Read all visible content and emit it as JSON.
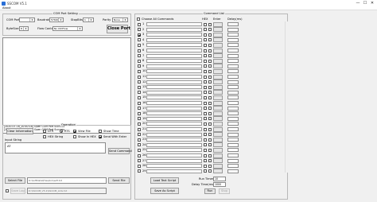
{
  "window": {
    "title": "SSCOM V5.1",
    "minimize": "—",
    "maximize": "☐",
    "close": "✕"
  },
  "menu": {
    "about": "About"
  },
  "com": {
    "group_title": "COM Port Setting",
    "port_label": "COM Port",
    "port_value": "",
    "baudrate_label": "Baudrate",
    "baudrate_value": "57600",
    "stopbits_label": "StopBits",
    "stopbits_value": "1",
    "parity_label": "Parity",
    "parity_value": "None",
    "bytesize_label": "ByteSize",
    "bytesize_value": "8",
    "flow_label": "Flow Control",
    "flow_value": "No CtrlFlow",
    "close_port": "Close Port"
  },
  "log_lines": [
    "[2020-07-16_20:40:18] Open COM Port Success",
    "[2020-07-16_20:40:19] Open COM Port Success"
  ],
  "operation": {
    "group_title": "Operation",
    "clear_info": "Clear Information",
    "dtr": "DTR",
    "rts": "RTS",
    "view_file": "View File",
    "show_time": "Show Time",
    "hex_string": "HEX String",
    "show_in_hex": "Show In HEX",
    "send_with_enter": "Send With Enter",
    "input_string_label": "Input String",
    "input_value": "AT",
    "send_command": "Send Command",
    "select_file": "Select File",
    "file_path": "D:\\SoftData\\Files\\bin\\wifi.txt",
    "send_file": "Send File",
    "save_log": "Save Log",
    "log_path": "D:\\SSCOM_V5.1\\SSCOM_LOG.txt",
    "send_log_checked": false
  },
  "command_list": {
    "group_title": "Command List",
    "choose_all": "Choose All Commands",
    "hex_header": "HEX",
    "enter_header": "Enter",
    "delay_header": "Delay(ms)",
    "rows": [
      "1",
      "2",
      "3",
      "4",
      "5",
      "6",
      "7",
      "8",
      "9",
      "10",
      "11",
      "12",
      "13",
      "14",
      "15",
      "16",
      "17",
      "18",
      "19",
      "20",
      "21",
      "22",
      "23",
      "24",
      "25",
      "26",
      "27",
      "28",
      "29"
    ],
    "checked_rows": [
      3
    ],
    "load_text_script": "Load Text Script",
    "save_as_script": "Save As Script",
    "run_times_label": "Run Times",
    "run_times_value": "10",
    "delay_time_label": "Delay Time(ms)",
    "delay_time_value": "1000",
    "run": "Run",
    "stop": "Stop"
  }
}
